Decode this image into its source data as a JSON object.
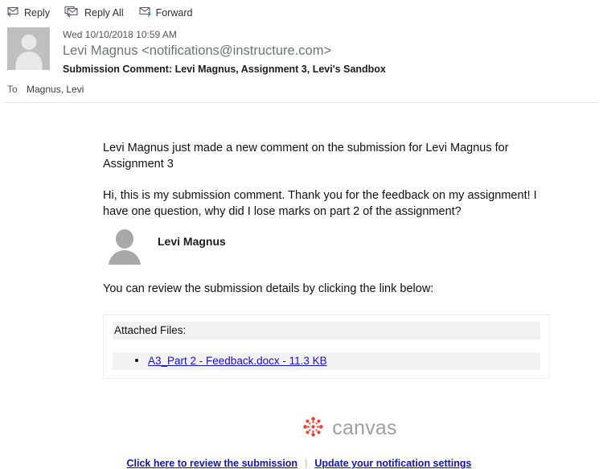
{
  "toolbar": {
    "actions": [
      {
        "label": "Reply",
        "icon": "reply-icon",
        "arrow_color": "#7b3fa0"
      },
      {
        "label": "Reply All",
        "icon": "reply-all-icon",
        "arrow_color": "#7b3fa0"
      },
      {
        "label": "Forward",
        "icon": "forward-icon",
        "arrow_color": "#2c7cc4"
      }
    ]
  },
  "header": {
    "avatar_icon": "person-avatar",
    "date": "Wed 10/10/2018 10:59 AM",
    "from": "Levi Magnus <notifications@instructure.com>",
    "subject": "Submission Comment: Levi Magnus, Assignment 3, Levi's Sandbox",
    "to_label": "To",
    "to_value": "Magnus, Levi"
  },
  "body": {
    "intro": "Levi Magnus just made a new comment on the submission for Levi Magnus for Assignment 3",
    "comment": "Hi, this is my submission comment. Thank you for the feedback on my assignment! I have one question, why did I lose marks on part 2 of the assignment?",
    "commenter_name": "Levi Magnus",
    "commenter_avatar_icon": "person-avatar",
    "review_text": "You can review the submission details by clicking the link below:"
  },
  "attachments": {
    "title": "Attached Files:",
    "files": [
      {
        "name": "A3_Part 2 - Feedback.docx - 11.3 KB"
      }
    ]
  },
  "branding": {
    "logo_icon": "canvas-logo-icon",
    "wordmark": "canvas",
    "logo_color": "#e7402e"
  },
  "footer": {
    "review_link": "Click here to review the submission ",
    "separator": "|",
    "settings_link": "Update your notification settings"
  }
}
